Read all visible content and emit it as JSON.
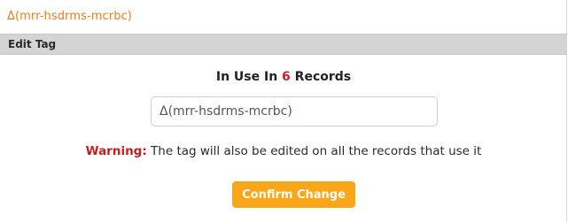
{
  "tag": {
    "name": "Δ(mrr-hsdrms-mcrbc)"
  },
  "header": {
    "title": "Edit Tag"
  },
  "usage": {
    "prefix": "In Use In ",
    "count": "6",
    "suffix": " Records"
  },
  "input": {
    "value": "Δ(mrr-hsdrms-mcrbc)"
  },
  "warning": {
    "label": "Warning:",
    "text": " The tag will also be edited on all the records that use it"
  },
  "actions": {
    "confirm_label": "Confirm Change"
  },
  "colors": {
    "accent_orange": "#f9a61b",
    "title_orange": "#f07a1c",
    "warning_red": "#cc1b1b",
    "header_gray": "#d4d4d4"
  }
}
